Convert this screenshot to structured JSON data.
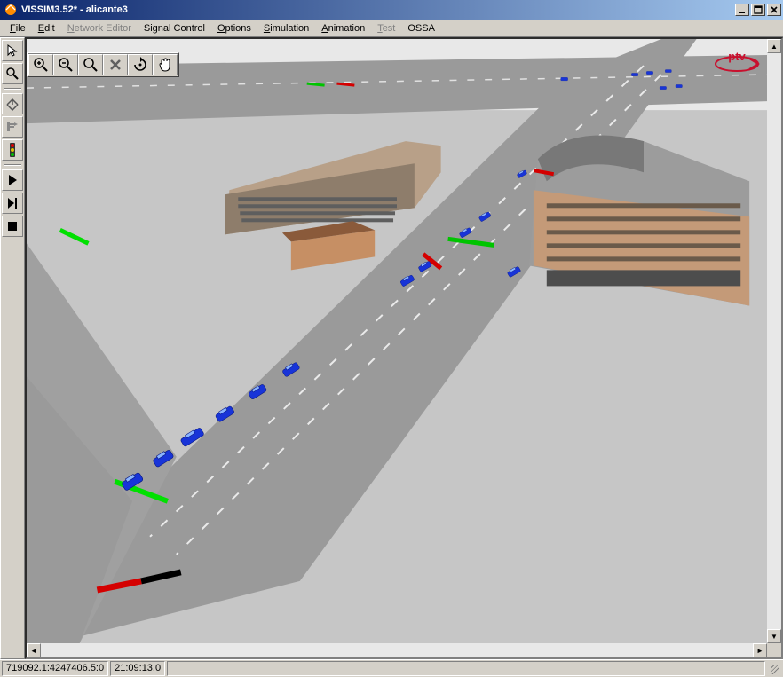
{
  "title": "VISSIM3.52* - alicante3",
  "menu": [
    {
      "label": "File",
      "mn": "F",
      "enabled": true
    },
    {
      "label": "Edit",
      "mn": "E",
      "enabled": true
    },
    {
      "label": "Network Editor",
      "mn": "N",
      "enabled": false
    },
    {
      "label": "Signal Control",
      "mn": "",
      "enabled": true
    },
    {
      "label": "Options",
      "mn": "O",
      "enabled": true
    },
    {
      "label": "Simulation",
      "mn": "S",
      "enabled": true
    },
    {
      "label": "Animation",
      "mn": "A",
      "enabled": true
    },
    {
      "label": "Test",
      "mn": "T",
      "enabled": false
    },
    {
      "label": "OSSA",
      "mn": "",
      "enabled": true
    }
  ],
  "vtoolbar": [
    {
      "name": "pointer-tool-icon"
    },
    {
      "name": "magnifier-icon"
    },
    {
      "name": "home-view-icon"
    },
    {
      "name": "link-tool-icon"
    },
    {
      "name": "signal-head-icon"
    },
    {
      "name": "sep"
    },
    {
      "name": "play-icon"
    },
    {
      "name": "step-icon"
    },
    {
      "name": "stop-icon"
    }
  ],
  "htoolbar": [
    {
      "name": "zoom-in-icon"
    },
    {
      "name": "zoom-out-icon"
    },
    {
      "name": "zoom-window-icon"
    },
    {
      "name": "cancel-zoom-icon"
    },
    {
      "name": "rotate-view-icon"
    },
    {
      "name": "pan-hand-icon"
    }
  ],
  "status": {
    "coords": "719092.1:4247406.5:0",
    "time": "21:09:13.0"
  },
  "logo_label": "ptv"
}
